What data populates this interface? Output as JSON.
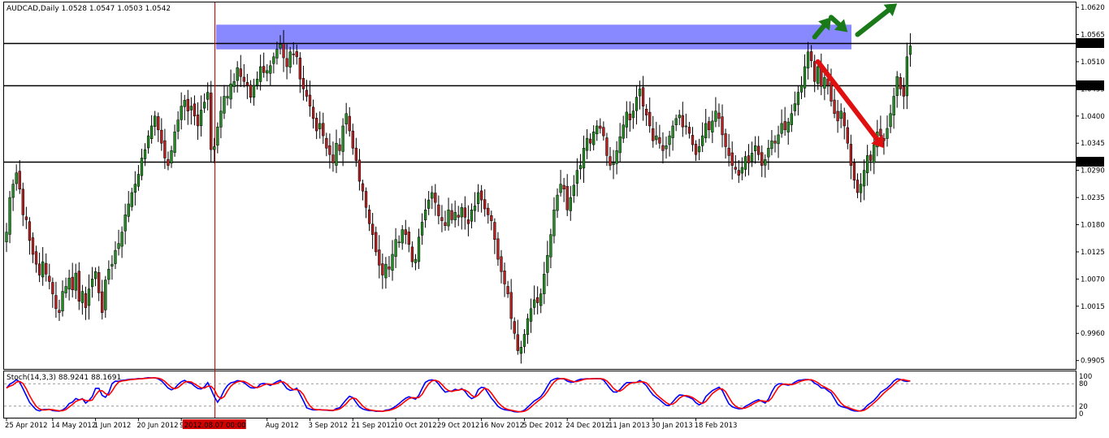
{
  "chart_data": {
    "type": "candlestick",
    "symbol_header": "AUDCAD,Daily  1.0528 1.0547 1.0503 1.0542",
    "price_ticks": [
      "1.0620",
      "1.0565",
      "1.0510",
      "1.0455",
      "1.0400",
      "1.0345",
      "1.0290",
      "1.0235",
      "1.0180",
      "1.0125",
      "1.0070",
      "1.0015",
      "0.9960",
      "0.9905"
    ],
    "price_tick_values": [
      1.062,
      1.0565,
      1.051,
      1.0455,
      1.04,
      1.0345,
      1.029,
      1.0235,
      1.018,
      1.0125,
      1.007,
      1.0015,
      0.996,
      0.9905
    ],
    "ylim": [
      0.9888,
      1.063
    ],
    "date_ticks": [
      "25 Apr 2012",
      "14 May 2012",
      "1 Jun 2012",
      "20 Jun 2012",
      "9 Jul 2012",
      "Aug 2012",
      "3 Sep 2012",
      "21 Sep 2012",
      "10 Oct 2012",
      "29 Oct 2012",
      "16 Nov 2012",
      "5 Dec 2012",
      "24 Dec 2012",
      "11 Jan 2013",
      "30 Jan 2013",
      "18 Feb 2013"
    ],
    "date_tick_index": [
      0,
      14,
      27,
      40,
      53,
      79,
      92,
      105,
      118,
      131,
      144,
      157,
      170,
      183,
      196,
      209
    ],
    "cursor_date_label": "2012.08.07 00:00",
    "cursor_index": 63,
    "levels": [
      {
        "label": "1.0547",
        "value": 1.0547
      },
      {
        "label": "1.0462",
        "value": 1.0462
      },
      {
        "label": "1.0308",
        "value": 1.0308
      }
    ],
    "resistance_zone": {
      "from_index": 46,
      "to_index": 241,
      "low": 1.0535,
      "high": 1.0585
    },
    "arrows": [
      {
        "color": "#1a7a1a",
        "from": [
          245,
          1.056
        ],
        "to": [
          250,
          1.06
        ]
      },
      {
        "color": "#1a7a1a",
        "from": [
          250,
          1.06
        ],
        "to": [
          255,
          1.057
        ]
      },
      {
        "color": "#1a7a1a",
        "from": [
          258,
          1.0565
        ],
        "to": [
          270,
          1.0628
        ]
      },
      {
        "color": "#e01010",
        "from": [
          246,
          1.051
        ],
        "to": [
          266,
          1.0335
        ]
      }
    ],
    "series_indices": [
      {
        "series": "close",
        "closes_start": 0
      }
    ],
    "closes": [
      1.0165,
      1.0235,
      1.0262,
      1.0285,
      1.0252,
      1.02,
      1.019,
      1.0148,
      1.012,
      1.01,
      1.0078,
      1.0105,
      1.008,
      1.0065,
      1.004,
      1.001,
      1.0002,
      1.0045,
      1.0055,
      1.0072,
      1.0048,
      1.0082,
      1.0025,
      1.0045,
      1.0012,
      1.005,
      1.007,
      1.0085,
      1.0042,
      1.0002,
      1.0068,
      1.009,
      1.01,
      1.0128,
      1.0142,
      1.0165,
      1.02,
      1.0222,
      1.0245,
      1.0262,
      1.0282,
      1.0315,
      1.0332,
      1.036,
      1.038,
      1.04,
      1.0372,
      1.0345,
      1.0315,
      1.03,
      1.033,
      1.0368,
      1.0392,
      1.042,
      1.0432,
      1.041,
      1.042,
      1.04,
      1.038,
      1.0412,
      1.0428,
      1.0448,
      1.0332,
      1.0338,
      1.0378,
      1.041,
      1.044,
      1.044,
      1.0465,
      1.047,
      1.0498,
      1.048,
      1.047,
      1.0462,
      1.0438,
      1.0462,
      1.0475,
      1.05,
      1.0488,
      1.0492,
      1.0502,
      1.052,
      1.0535,
      1.0545,
      1.0518,
      1.05,
      1.053,
      1.0525,
      1.052,
      1.0475,
      1.0455,
      1.044,
      1.042,
      1.0395,
      1.037,
      1.0385,
      1.036,
      1.0335,
      1.0322,
      1.0305,
      1.0345,
      1.033,
      1.038,
      1.0405,
      1.037,
      1.0335,
      1.031,
      1.0268,
      1.0248,
      1.0215,
      1.0182,
      1.016,
      1.0125,
      1.0098,
      1.0078,
      1.01,
      1.009,
      1.012,
      1.015,
      1.0145,
      1.017,
      1.016,
      1.014,
      1.0105,
      1.011,
      1.0155,
      1.0185,
      1.021,
      1.023,
      1.0245,
      1.0225,
      1.0198,
      1.0188,
      1.0178,
      1.021,
      1.019,
      1.0205,
      1.0195,
      1.0215,
      1.0195,
      1.0182,
      1.021,
      1.0218,
      1.0245,
      1.023,
      1.0212,
      1.02,
      1.0188,
      1.015,
      1.011,
      1.0085,
      1.006,
      1.004,
      0.999,
      0.996,
      0.9925,
      0.9932,
      0.9958,
      0.999,
      1.001,
      1.0028,
      1.0022,
      1.004,
      1.008,
      1.0118,
      1.016,
      1.021,
      1.024,
      1.0262,
      1.0252,
      1.021,
      1.0235,
      1.026,
      1.029,
      1.03,
      1.0335,
      1.0355,
      1.0345,
      1.0368,
      1.038,
      1.0375,
      1.036,
      1.032,
      1.03,
      1.0305,
      1.033,
      1.0358,
      1.0382,
      1.0408,
      1.0392,
      1.041,
      1.0438,
      1.0455,
      1.042,
      1.0402,
      1.038,
      1.035,
      1.036,
      1.0345,
      1.033,
      1.034,
      1.036,
      1.038,
      1.0395,
      1.0402,
      1.0378,
      1.038,
      1.0365,
      1.0342,
      1.0322,
      1.0338,
      1.036,
      1.0385,
      1.0372,
      1.039,
      1.041,
      1.0395,
      1.0362,
      1.0338,
      1.032,
      1.03,
      1.0292,
      1.028,
      1.0296,
      1.0318,
      1.0305,
      1.0325,
      1.034,
      1.0322,
      1.03,
      1.0312,
      1.0335,
      1.035,
      1.0345,
      1.0362,
      1.0385,
      1.0372,
      1.0388,
      1.0405,
      1.0425,
      1.0448,
      1.0462,
      1.05,
      1.053,
      1.0512,
      1.047,
      1.05,
      1.046,
      1.0478,
      1.0462,
      1.043,
      1.0405,
      1.039,
      1.041,
      1.038,
      1.0345,
      1.03,
      1.027,
      1.0245,
      1.0262,
      1.029,
      1.032,
      1.031,
      1.0342,
      1.0368,
      1.036,
      1.035,
      1.0375,
      1.0405,
      1.044,
      1.048,
      1.0455,
      1.044,
      1.052,
      1.0542
    ],
    "stoch_label": "Stoch(14,3,3) 88.9241 88.1691",
    "stoch_ticks": [
      "100",
      "80",
      "20",
      "0"
    ],
    "stoch_tick_values": [
      100,
      80,
      20,
      0
    ],
    "stoch_levels": [
      80,
      20
    ],
    "colors": {
      "bull": "#228B22",
      "bear": "#B22222",
      "wick": "#000000",
      "zone": "#6666ff",
      "level_line": "#000000",
      "cursor_line": "#cc0000",
      "stoch_main": "#0000ff",
      "stoch_signal": "#ff0000",
      "label_box": "#000000",
      "label_text": "#ffffff",
      "cursor_label_bg": "#d40000"
    }
  }
}
